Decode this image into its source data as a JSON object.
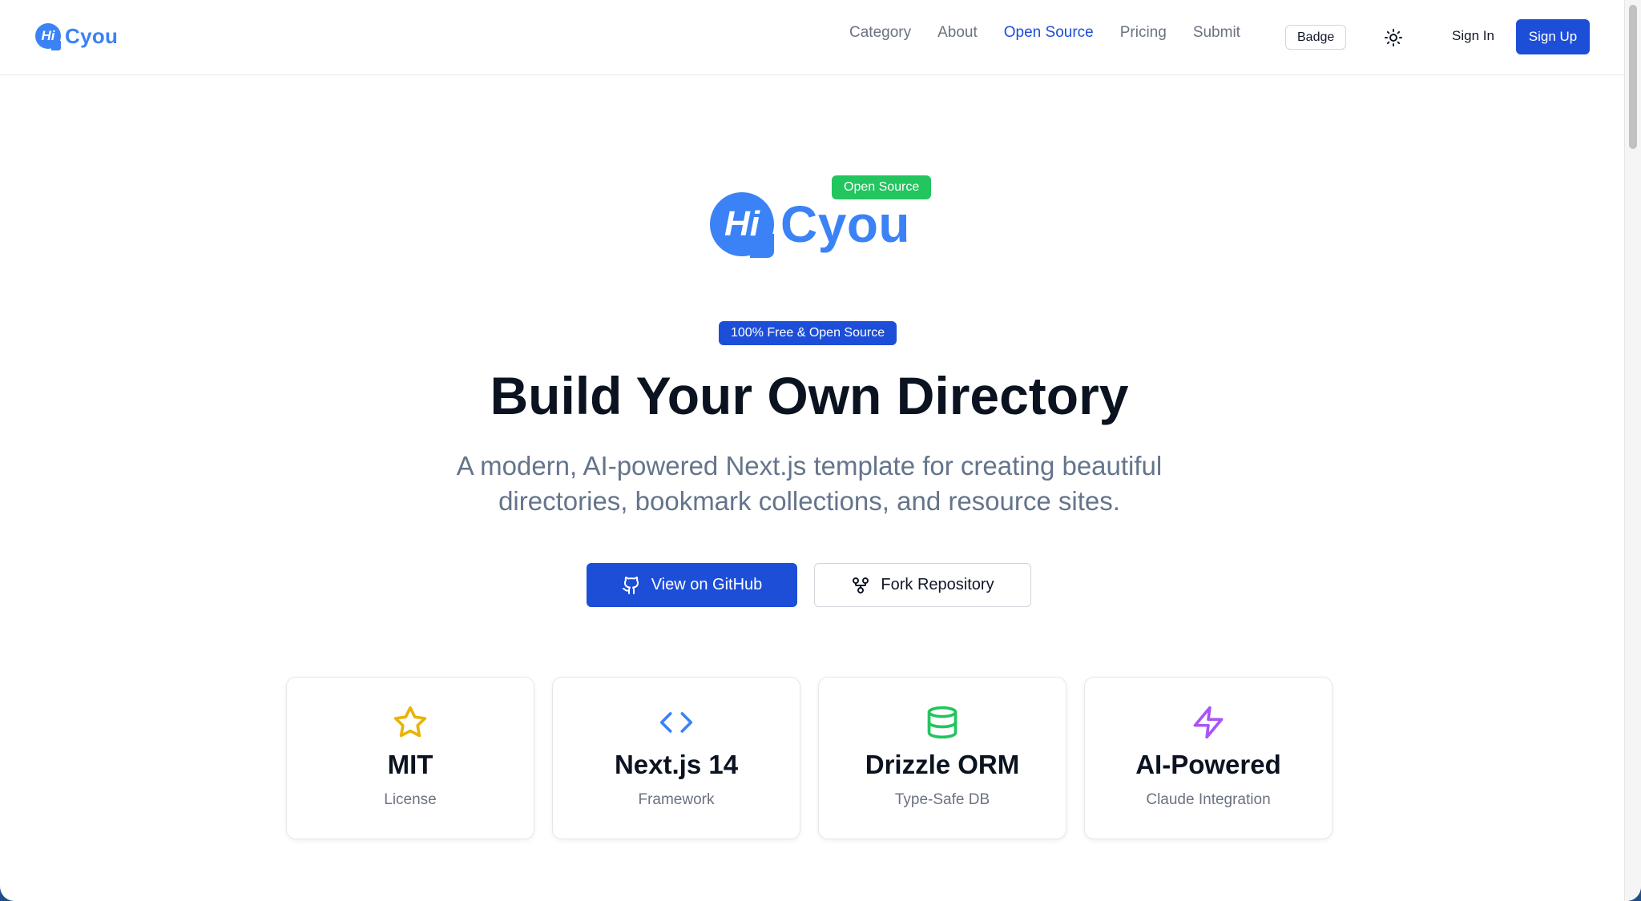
{
  "header": {
    "brand_mark": "Hi",
    "brand_name": "Cyou",
    "nav": [
      {
        "label": "Category"
      },
      {
        "label": "About"
      },
      {
        "label": "Open Source"
      },
      {
        "label": "Pricing"
      },
      {
        "label": "Submit"
      }
    ],
    "active_nav": "Open Source",
    "badge_label": "Badge",
    "theme_icon": "sun-icon",
    "sign_in": "Sign In",
    "sign_up": "Sign Up"
  },
  "hero": {
    "logo_mark": "Hi",
    "logo_name": "Cyou",
    "logo_tag": "Open Source",
    "pill": "100% Free & Open Source",
    "title": "Build Your Own Directory",
    "subtitle_line1": "A modern, AI-powered Next.js template for creating beautiful",
    "subtitle_line2": "directories, bookmark collections, and resource sites.",
    "primary_button": "View on GitHub",
    "secondary_button": "Fork Repository"
  },
  "features": [
    {
      "icon": "star-icon",
      "title": "MIT",
      "subtitle": "License",
      "color": "#eab308"
    },
    {
      "icon": "code-icon",
      "title": "Next.js 14",
      "subtitle": "Framework",
      "color": "#3b82f6"
    },
    {
      "icon": "database-icon",
      "title": "Drizzle ORM",
      "subtitle": "Type-Safe DB",
      "color": "#22c55e"
    },
    {
      "icon": "zap-icon",
      "title": "AI-Powered",
      "subtitle": "Claude Integration",
      "color": "#a855f7"
    }
  ],
  "colors": {
    "primary": "#1d4ed8",
    "brand": "#3b82f6",
    "success": "#22c55e"
  }
}
